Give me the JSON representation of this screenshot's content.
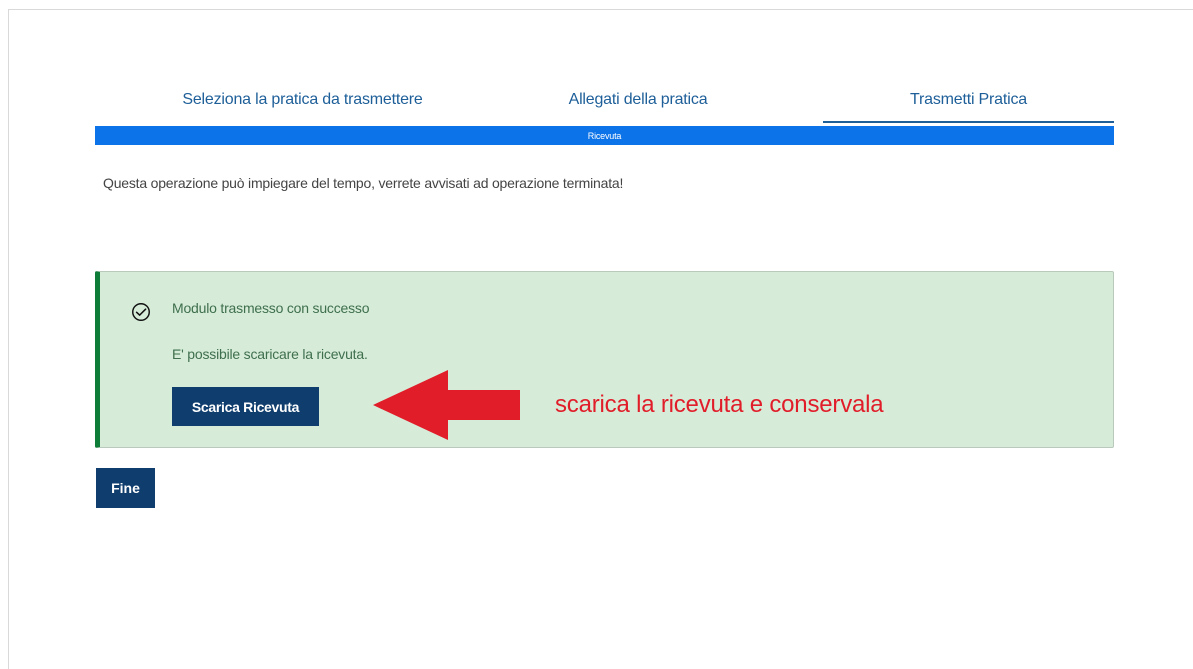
{
  "tabs": [
    {
      "label": "Seleziona la pratica da trasmettere"
    },
    {
      "label": "Allegati della pratica"
    },
    {
      "label": "Trasmetti Pratica"
    }
  ],
  "progress": {
    "label": "Ricevuta",
    "value_percent": 100
  },
  "info": {
    "text": "Questa operazione può impiegare del tempo, verrete avvisati ad operazione terminata!"
  },
  "alert": {
    "icon": "check-circle-icon",
    "title": "Modulo trasmesso con successo",
    "subtitle": "E' possibile scaricare la ricevuta.",
    "button_label": "Scarica Ricevuta"
  },
  "annotation": {
    "text": "scarica la ricevuta e conservala",
    "arrow_icon": "red-left-arrow-icon"
  },
  "actions": {
    "finish_label": "Fine"
  },
  "colors": {
    "tab_text": "#1e5f99",
    "progress_fill": "#0d73e8",
    "alert_background": "#d6ecd8",
    "alert_border": "#0d7d38",
    "primary_button": "#0f3d6d",
    "annotation_red": "#e11d2a"
  }
}
